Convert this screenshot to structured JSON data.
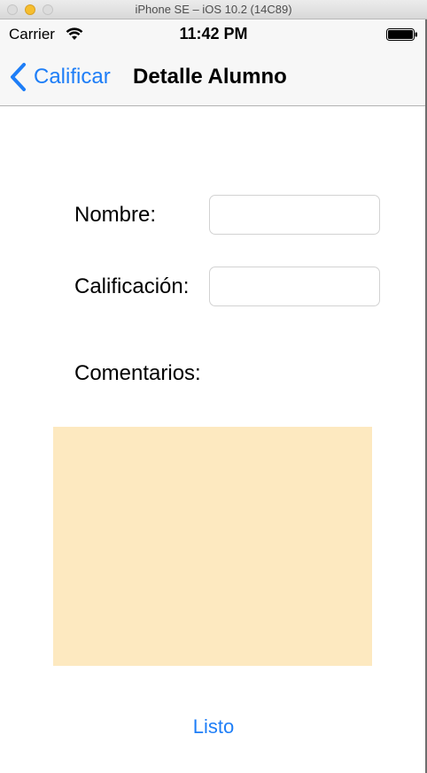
{
  "window": {
    "title": "iPhone SE – iOS 10.2 (14C89)"
  },
  "status_bar": {
    "carrier": "Carrier",
    "time": "11:42 PM",
    "wifi_icon": "wifi-icon",
    "battery_icon": "battery-icon"
  },
  "nav": {
    "back_label": "Calificar",
    "back_icon": "chevron-left-icon",
    "title": "Detalle Alumno"
  },
  "form": {
    "nombre_label": "Nombre:",
    "nombre_value": "",
    "calificacion_label": "Calificación:",
    "calificacion_value": "",
    "comentarios_label": "Comentarios:",
    "comentarios_value": ""
  },
  "actions": {
    "done_label": "Listo"
  },
  "colors": {
    "accent": "#1e7ef7",
    "comments_background": "#fde9c0",
    "bar_background": "#f7f7f7"
  }
}
